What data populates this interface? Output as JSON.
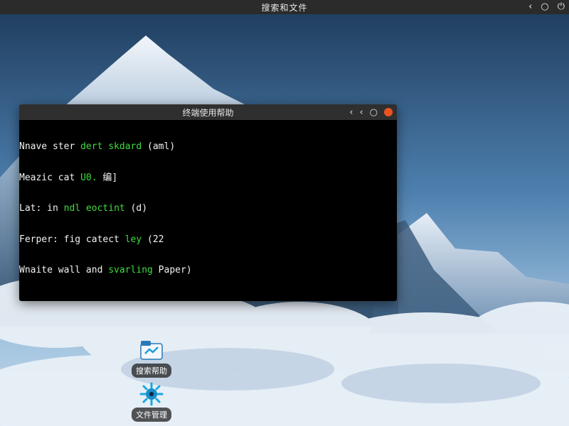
{
  "topbar": {
    "title": "搜索和文件",
    "back_glyph": "‹",
    "circle_glyph": "○",
    "close_glyph": "⏻"
  },
  "terminal": {
    "title": "终端使用帮助",
    "back_glyph": "‹",
    "back2_glyph": "‹",
    "circle_glyph": "○",
    "lines": [
      {
        "a": "Nnave ster ",
        "b": "dert skdard",
        "c": " (aml)"
      },
      {
        "a": "Meazic cat ",
        "b": "U0.",
        "c": " 编]"
      },
      {
        "a": "Lat: in ",
        "b": "ndl eoctint",
        "c": " (d)"
      },
      {
        "a": "Ferper: fig catect ",
        "b": "ley",
        "c": " (22"
      },
      {
        "a": "Wnaite wall and ",
        "b": "svarling",
        "c": " Paper)"
      }
    ]
  },
  "desktop": {
    "icon1_label": "搜索帮助",
    "icon2_label": "文件管理"
  },
  "colors": {
    "accent": "#e95420",
    "terminal_green": "#3ddc3d"
  }
}
